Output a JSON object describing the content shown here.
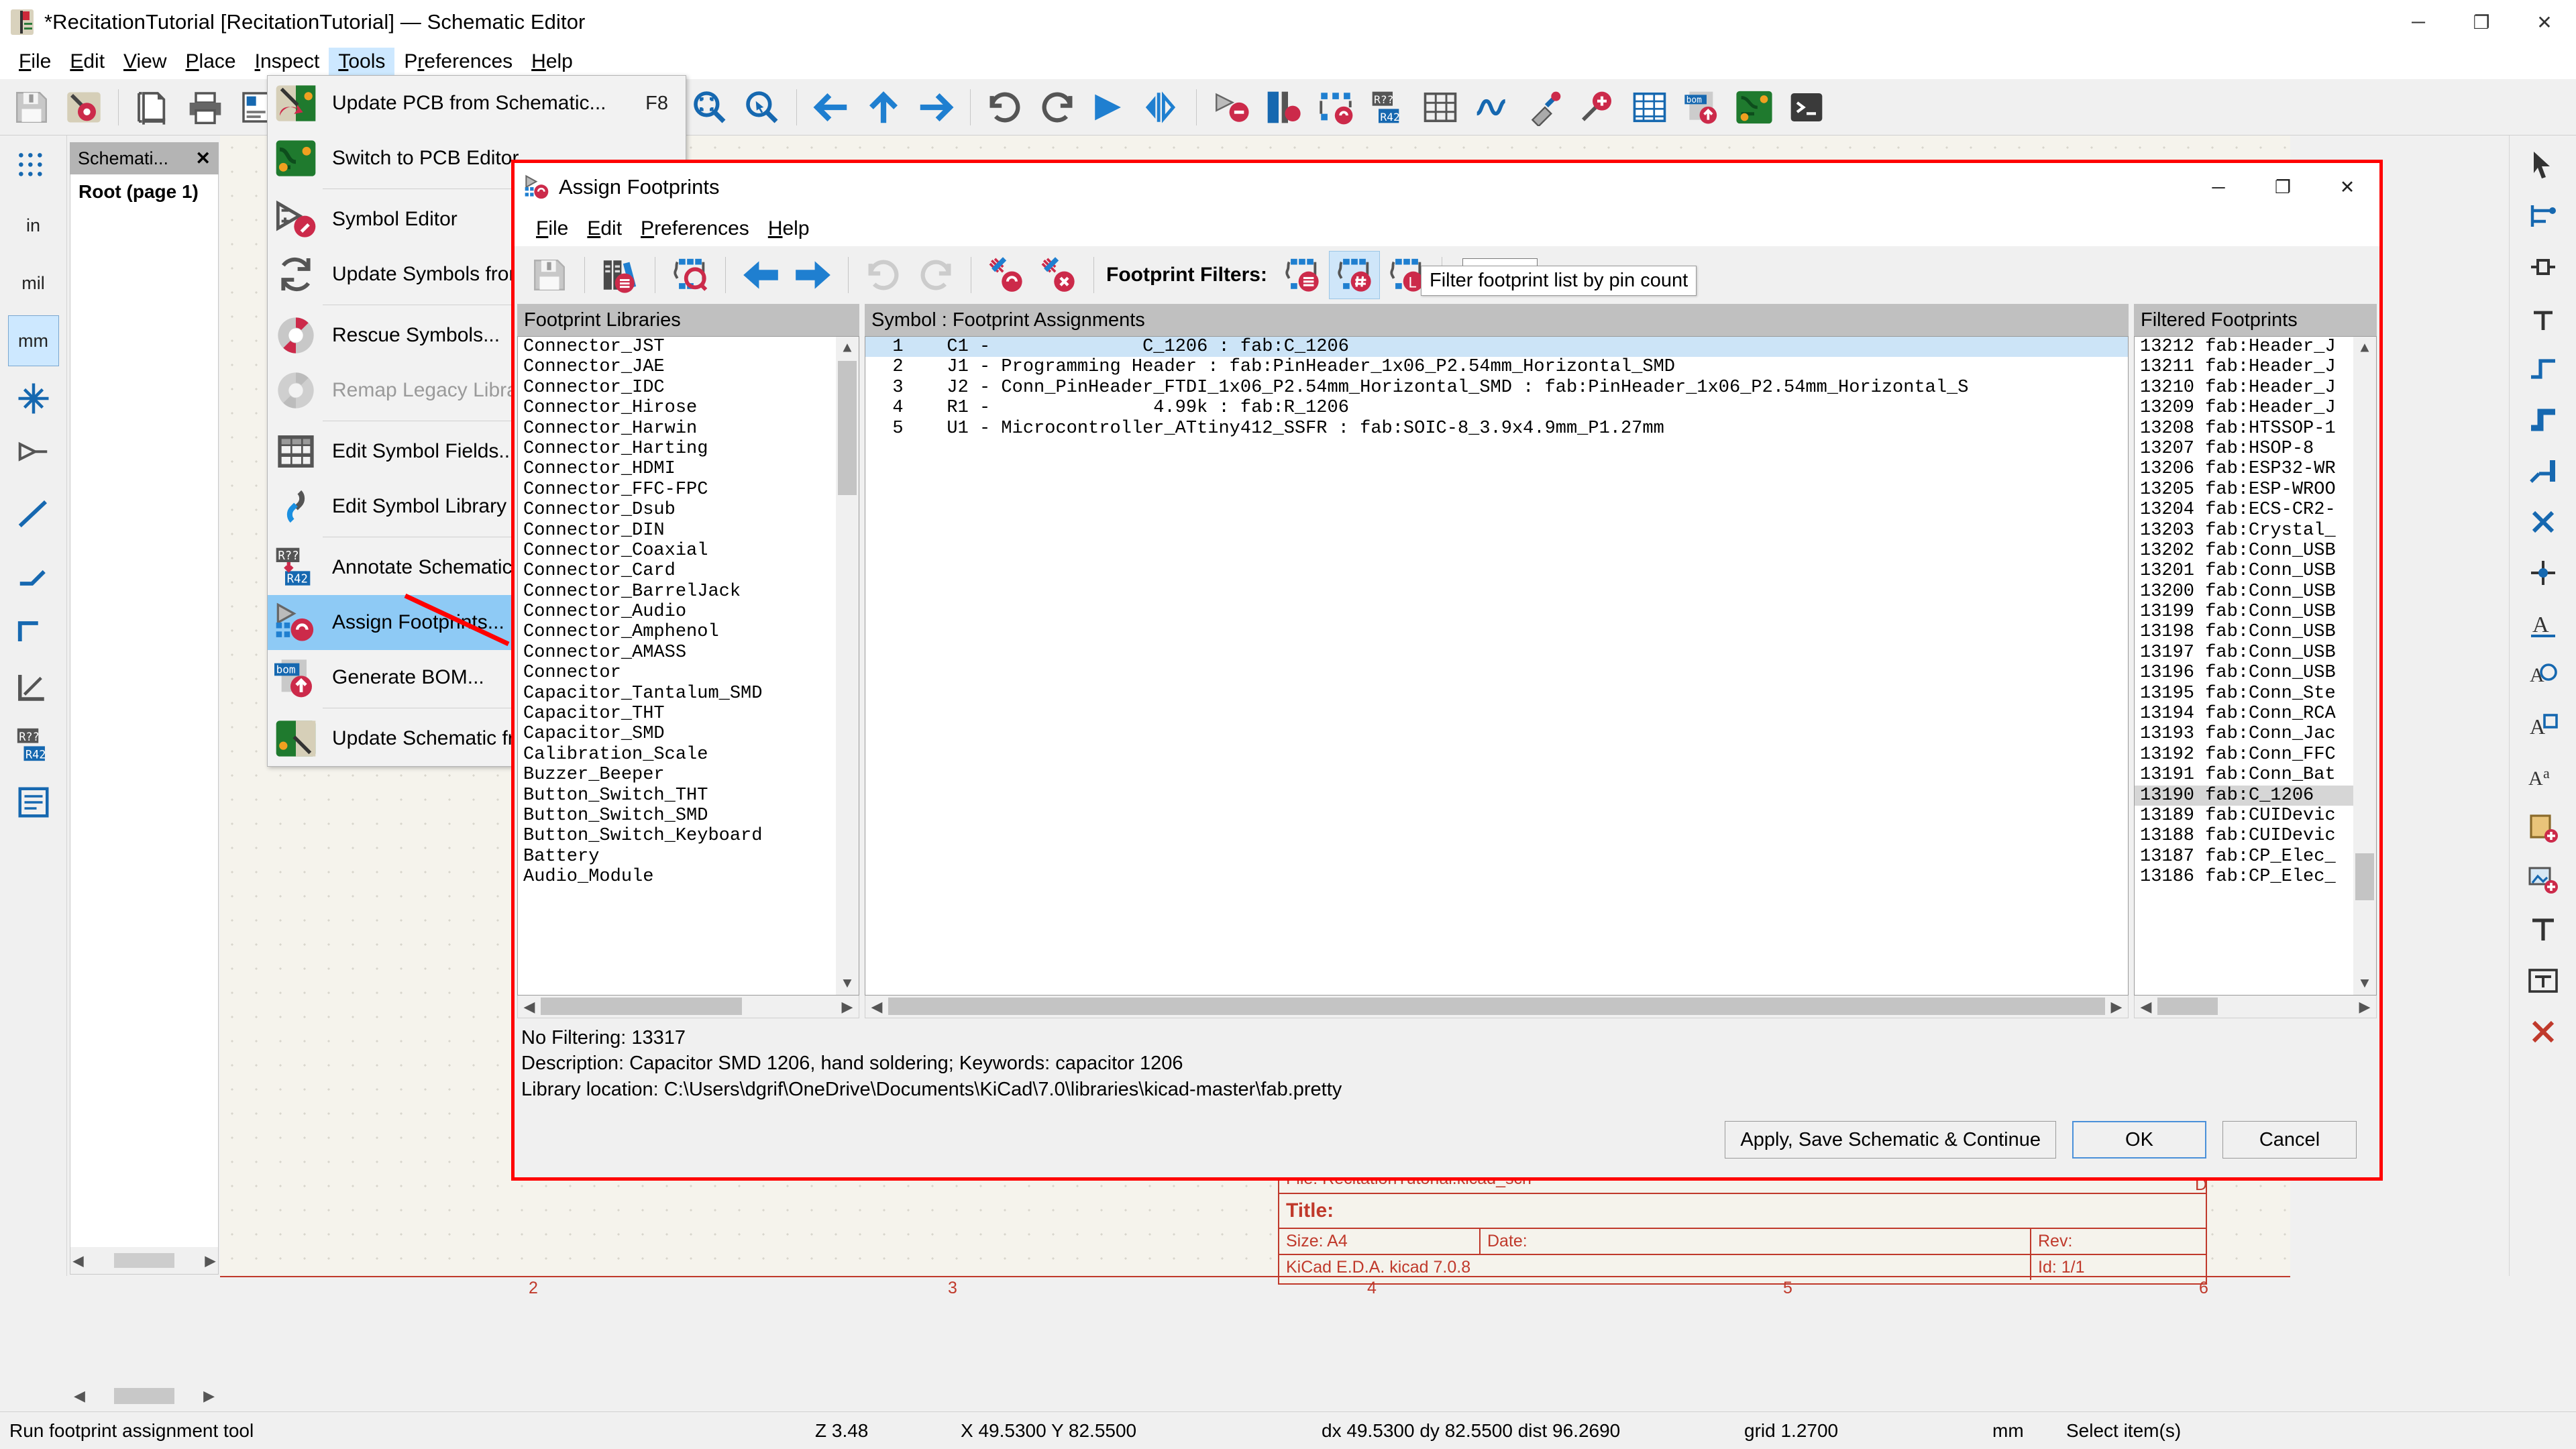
{
  "window": {
    "title": "*RecitationTutorial [RecitationTutorial] — Schematic Editor",
    "minimize": "─",
    "maximize": "❐",
    "close": "✕"
  },
  "menubar": {
    "items": [
      {
        "label": "File"
      },
      {
        "label": "Edit"
      },
      {
        "label": "View"
      },
      {
        "label": "Place"
      },
      {
        "label": "Inspect"
      },
      {
        "label": "Tools",
        "active": true
      },
      {
        "label": "Preferences"
      },
      {
        "label": "Help"
      }
    ]
  },
  "tools_menu": {
    "items": [
      {
        "label": "Update PCB from Schematic...",
        "accel": "F8",
        "icon": "update-pcb-icon"
      },
      {
        "label": "Switch to PCB Editor",
        "accel": "",
        "icon": "pcb-editor-icon"
      },
      {
        "sep": true
      },
      {
        "label": "Symbol Editor",
        "accel": "",
        "icon": "symbol-editor-icon"
      },
      {
        "label": "Update Symbols from Library...",
        "accel": "",
        "icon": "update-symbols-icon"
      },
      {
        "sep": true
      },
      {
        "label": "Rescue Symbols...",
        "accel": "",
        "icon": "rescue-symbols-icon"
      },
      {
        "label": "Remap Legacy Library Symbols...",
        "accel": "",
        "icon": "remap-legacy-icon",
        "disabled": true
      },
      {
        "sep": true
      },
      {
        "label": "Edit Symbol Fields...",
        "accel": "",
        "icon": "edit-fields-icon"
      },
      {
        "label": "Edit Symbol Library Links...",
        "accel": "",
        "icon": "edit-library-links-icon"
      },
      {
        "sep": true
      },
      {
        "label": "Annotate Schematic...",
        "accel": "",
        "icon": "annotate-icon"
      },
      {
        "label": "Assign Footprints...",
        "accel": "",
        "icon": "assign-footprints-icon",
        "selected": true
      },
      {
        "label": "Generate BOM...",
        "accel": "",
        "icon": "bom-icon"
      },
      {
        "sep": true
      },
      {
        "label": "Update Schematic from PCB...",
        "accel": "",
        "icon": "update-schematic-icon"
      }
    ]
  },
  "schematic_panel": {
    "tab_label": "Schemati...",
    "close_glyph": "✕",
    "root_label": "Root (page 1)"
  },
  "dialog": {
    "title": "Assign Footprints",
    "minimize": "─",
    "maximize": "❐",
    "close": "✕",
    "menu": [
      {
        "label": "File"
      },
      {
        "label": "Edit"
      },
      {
        "label": "Preferences"
      },
      {
        "label": "Help"
      }
    ],
    "toolbar": {
      "save_icon": "save-icon",
      "library_icon": "footprint-library-icon",
      "view_footprint_icon": "view-selected-footprint-icon",
      "prev_icon": "previous-arrow-icon",
      "next_icon": "next-arrow-icon",
      "undo_icon": "undo-icon",
      "redo_icon": "redo-icon",
      "auto_assign_icon": "auto-assign-icon",
      "delete_assign_icon": "delete-assignments-icon",
      "filters_label": "Footprint Filters:",
      "filter_by_keyword_icon": "filter-by-keyword-icon",
      "filter_by_pincount_icon": "filter-by-pin-count-icon",
      "filter_by_library_icon": "filter-by-library-icon",
      "search_value": "",
      "search_placeholder": ""
    },
    "tooltip": "Filter footprint list by pin count",
    "panes": {
      "libraries": {
        "header": "Footprint Libraries",
        "items": [
          "Audio_Module",
          "Battery",
          "Button_Switch_Keyboard",
          "Button_Switch_SMD",
          "Button_Switch_THT",
          "Buzzer_Beeper",
          "Calibration_Scale",
          "Capacitor_SMD",
          "Capacitor_THT",
          "Capacitor_Tantalum_SMD",
          "Connector",
          "Connector_AMASS",
          "Connector_Amphenol",
          "Connector_Audio",
          "Connector_BarrelJack",
          "Connector_Card",
          "Connector_Coaxial",
          "Connector_DIN",
          "Connector_Dsub",
          "Connector_FFC-FPC",
          "Connector_HDMI",
          "Connector_Harting",
          "Connector_Harwin",
          "Connector_Hirose",
          "Connector_IDC",
          "Connector_JAE",
          "Connector_JST"
        ]
      },
      "assignments": {
        "header": "Symbol : Footprint Assignments",
        "rows": [
          {
            "num": "1",
            "text": "C1 -              C_1206 : fab:C_1206",
            "selected": true
          },
          {
            "num": "2",
            "text": "J1 - Programming Header : fab:PinHeader_1x06_P2.54mm_Horizontal_SMD",
            "selected": false
          },
          {
            "num": "3",
            "text": "J2 - Conn_PinHeader_FTDI_1x06_P2.54mm_Horizontal_SMD : fab:PinHeader_1x06_P2.54mm_Horizontal_S",
            "selected": false
          },
          {
            "num": "4",
            "text": "R1 -               4.99k : fab:R_1206",
            "selected": false
          },
          {
            "num": "5",
            "text": "U1 - Microcontroller_ATtiny412_SSFR : fab:SOIC-8_3.9x4.9mm_P1.27mm",
            "selected": false
          }
        ]
      },
      "filtered": {
        "header": "Filtered Footprints",
        "items": [
          {
            "num": "13186",
            "name": "fab:CP_Elec_",
            "selected": false
          },
          {
            "num": "13187",
            "name": "fab:CP_Elec_",
            "selected": false
          },
          {
            "num": "13188",
            "name": "fab:CUIDevic",
            "selected": false
          },
          {
            "num": "13189",
            "name": "fab:CUIDevic",
            "selected": false
          },
          {
            "num": "13190",
            "name": "fab:C_1206",
            "selected": true
          },
          {
            "num": "13191",
            "name": "fab:Conn_Bat",
            "selected": false
          },
          {
            "num": "13192",
            "name": "fab:Conn_FFC",
            "selected": false
          },
          {
            "num": "13193",
            "name": "fab:Conn_Jac",
            "selected": false
          },
          {
            "num": "13194",
            "name": "fab:Conn_RCA",
            "selected": false
          },
          {
            "num": "13195",
            "name": "fab:Conn_Ste",
            "selected": false
          },
          {
            "num": "13196",
            "name": "fab:Conn_USB",
            "selected": false
          },
          {
            "num": "13197",
            "name": "fab:Conn_USB",
            "selected": false
          },
          {
            "num": "13198",
            "name": "fab:Conn_USB",
            "selected": false
          },
          {
            "num": "13199",
            "name": "fab:Conn_USB",
            "selected": false
          },
          {
            "num": "13200",
            "name": "fab:Conn_USB",
            "selected": false
          },
          {
            "num": "13201",
            "name": "fab:Conn_USB",
            "selected": false
          },
          {
            "num": "13202",
            "name": "fab:Conn_USB",
            "selected": false
          },
          {
            "num": "13203",
            "name": "fab:Crystal_",
            "selected": false
          },
          {
            "num": "13204",
            "name": "fab:ECS-CR2-",
            "selected": false
          },
          {
            "num": "13205",
            "name": "fab:ESP-WROO",
            "selected": false
          },
          {
            "num": "13206",
            "name": "fab:ESP32-WR",
            "selected": false
          },
          {
            "num": "13207",
            "name": "fab:HSOP-8",
            "selected": false
          },
          {
            "num": "13208",
            "name": "fab:HTSSOP-1",
            "selected": false
          },
          {
            "num": "13209",
            "name": "fab:Header_J",
            "selected": false
          },
          {
            "num": "13210",
            "name": "fab:Header_J",
            "selected": false
          },
          {
            "num": "13211",
            "name": "fab:Header_J",
            "selected": false
          },
          {
            "num": "13212",
            "name": "fab:Header_J",
            "selected": false
          }
        ]
      }
    },
    "info": {
      "filtering": "No Filtering: 13317",
      "description": "Description: Capacitor SMD 1206, hand soldering;  Keywords: capacitor 1206",
      "library_location": "Library location: C:\\Users\\dgrif\\OneDrive\\Documents\\KiCad\\7.0\\libraries\\kicad-master\\fab.pretty"
    },
    "buttons": {
      "apply": "Apply, Save Schematic & Continue",
      "ok": "OK",
      "cancel": "Cancel"
    }
  },
  "title_block": {
    "file": "File: RecitationTutorial.kicad_sch",
    "title_label": "Title:",
    "size": "Size: A4",
    "date": "Date:",
    "rev": "Rev:",
    "eda": "KiCad E.D.A.   kicad 7.0.8",
    "id": "Id: 1/1",
    "corner": "D"
  },
  "ruler": {
    "marks": [
      "2",
      "3",
      "4",
      "5",
      "6"
    ]
  },
  "left_toolbar": {
    "items": [
      {
        "label": "",
        "icon": "grid-icon",
        "selected": false
      },
      {
        "label": "in",
        "icon": "unit-inches-icon",
        "selected": false
      },
      {
        "label": "mil",
        "icon": "unit-mils-icon",
        "selected": false
      },
      {
        "label": "mm",
        "icon": "unit-mm-icon",
        "selected": true
      },
      {
        "label": "",
        "icon": "cursor-crosshair-icon",
        "selected": false
      },
      {
        "label": "",
        "icon": "hidden-pins-icon",
        "selected": false
      },
      {
        "label": "",
        "icon": "line-mode-free-icon",
        "selected": false
      },
      {
        "label": "",
        "icon": "line-mode-90-icon",
        "selected": false
      },
      {
        "label": "",
        "icon": "line-mode-45-icon",
        "selected": false
      },
      {
        "label": "",
        "icon": "annotate-r42-icon",
        "selected": false
      },
      {
        "label": "",
        "icon": "hierarchy-navigator-icon",
        "selected": false
      }
    ]
  },
  "right_toolbar": {
    "items": [
      {
        "icon": "select-arrow-icon"
      },
      {
        "icon": "highlight-net-icon"
      },
      {
        "icon": "place-symbol-icon"
      },
      {
        "icon": "place-power-icon"
      },
      {
        "icon": "draw-wire-icon"
      },
      {
        "icon": "draw-bus-icon"
      },
      {
        "icon": "wire-to-bus-icon"
      },
      {
        "icon": "no-connect-icon"
      },
      {
        "icon": "junction-icon"
      },
      {
        "icon": "net-label-icon"
      },
      {
        "icon": "global-label-icon"
      },
      {
        "icon": "hierarchical-label-icon"
      },
      {
        "icon": "sheet-pin-icon"
      },
      {
        "icon": "text-box-icon"
      },
      {
        "icon": "add-image-icon"
      },
      {
        "icon": "delete-icon"
      },
      {
        "icon": "text-tool-icon"
      },
      {
        "icon": "table-tool-icon"
      }
    ]
  },
  "statusbar": {
    "message": "Run footprint assignment tool",
    "zoom": "Z 3.48",
    "coords": "X 49.5300  Y 82.5500",
    "delta": "dx 49.5300  dy 82.5500  dist 96.2690",
    "grid": "grid 1.2700",
    "units": "mm",
    "select": "Select item(s)"
  }
}
